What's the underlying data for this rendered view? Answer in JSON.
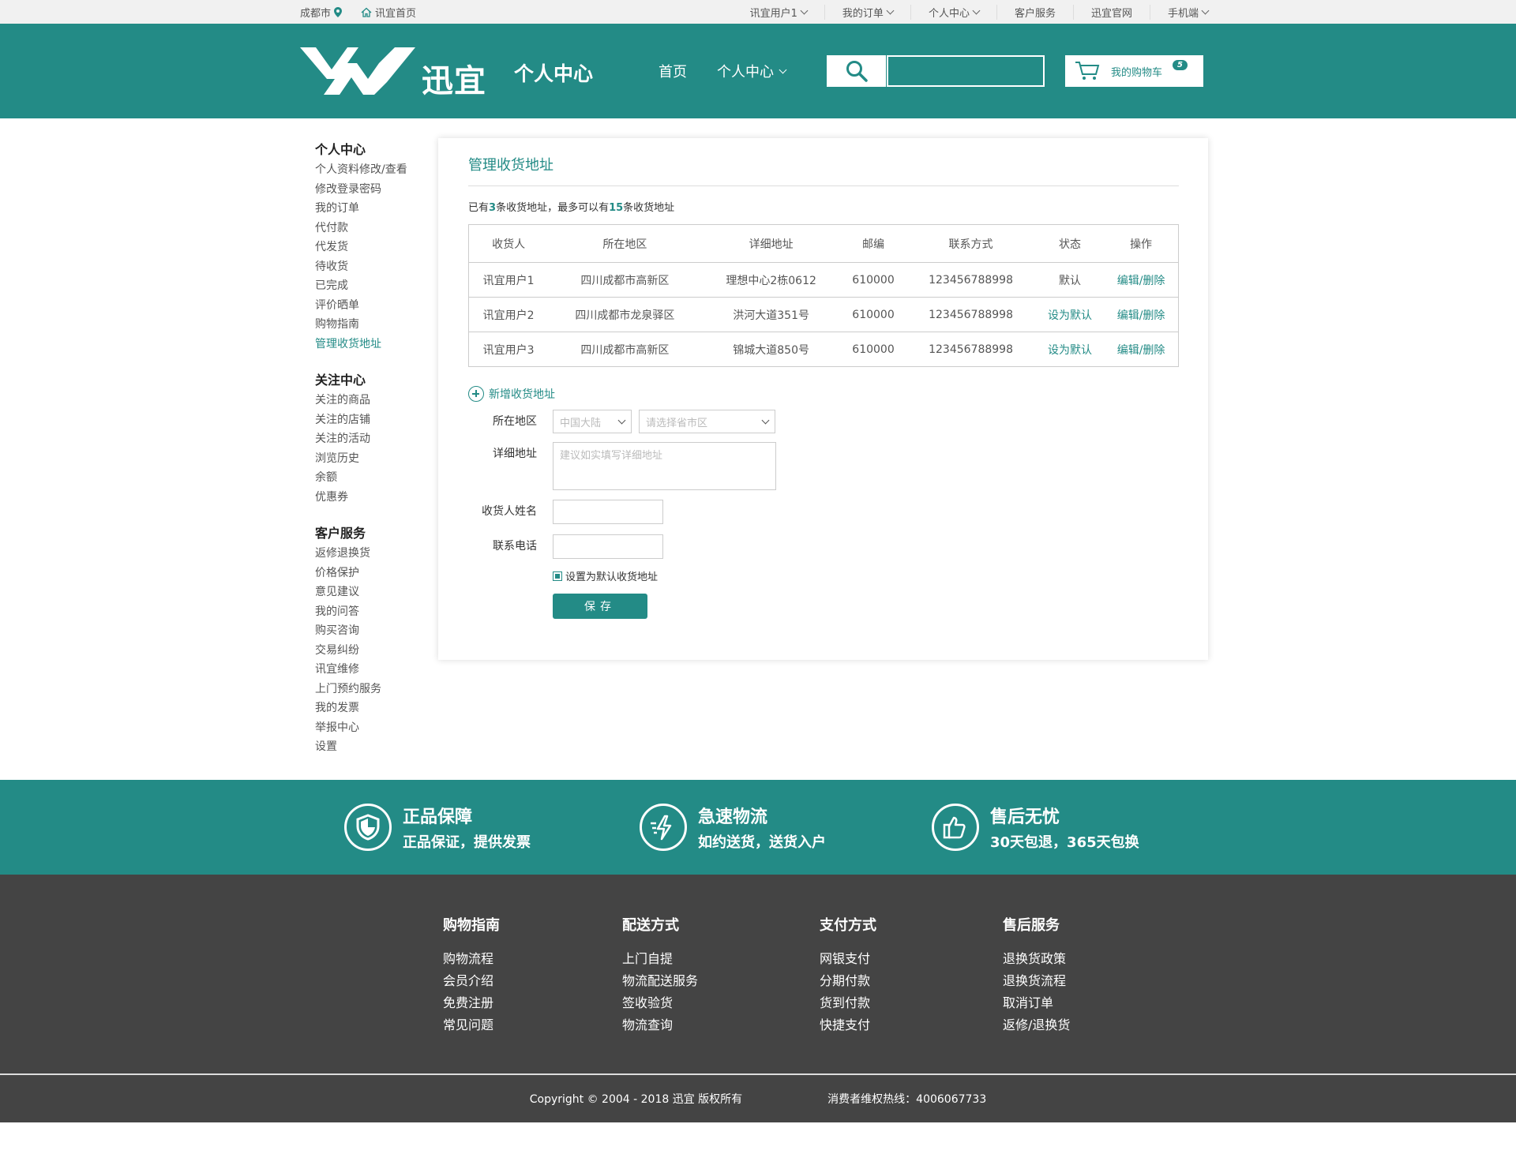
{
  "topbar": {
    "city": "成都市",
    "home": "讯宜首页",
    "links": [
      "讯宜用户1",
      "我的订单",
      "个人中心",
      "客户服务",
      "迅宜官网",
      "手机端"
    ]
  },
  "header": {
    "logo_text": "迅宜",
    "title": "个人中心",
    "nav": [
      "首页",
      "个人中心"
    ],
    "search_placeholder": "",
    "cart_label": "我的购物车",
    "cart_count": "5"
  },
  "sidebar": {
    "groups": [
      {
        "title": "个人中心",
        "items": [
          "个人资料修改/查看",
          "修改登录密码",
          "我的订单",
          "代付款",
          "代发货",
          "待收货",
          "已完成",
          "评价晒单",
          "购物指南",
          "管理收货地址"
        ]
      },
      {
        "title": "关注中心",
        "items": [
          "关注的商品",
          "关注的店铺",
          "关注的活动",
          "浏览历史",
          "余额",
          "优惠券"
        ]
      },
      {
        "title": "客户服务",
        "items": [
          "返修退换货",
          "价格保护",
          "意见建议",
          "我的问答",
          "购买咨询",
          "交易纠纷",
          "讯宜维修",
          "上门预约服务",
          "我的发票",
          "举报中心",
          "设置"
        ]
      }
    ],
    "active": "管理收货地址"
  },
  "main": {
    "title": "管理收货地址",
    "count_prefix": "已有",
    "count_have": "3",
    "count_mid": "条收货地址，最多可以有",
    "count_max": "15",
    "count_suffix": "条收货地址",
    "table": {
      "headers": [
        "收货人",
        "所在地区",
        "详细地址",
        "邮编",
        "联系方式",
        "状态",
        "操作"
      ],
      "rows": [
        [
          "讯宜用户1",
          "四川成都市高新区",
          "理想中心2栋0612",
          "610000",
          "123456788998",
          "默认",
          "编辑/删除"
        ],
        [
          "讯宜用户2",
          "四川成都市龙泉驿区",
          "洪河大道351号",
          "610000",
          "123456788998",
          "设为默认",
          "编辑/删除"
        ],
        [
          "讯宜用户3",
          "四川成都市高新区",
          "锦城大道850号",
          "610000",
          "123456788998",
          "设为默认",
          "编辑/删除"
        ]
      ]
    },
    "add_new": "新增收货地址",
    "form": {
      "region_label": "所在地区",
      "country_placeholder": "中国大陆",
      "province_placeholder": "请选择省市区",
      "address_label": "详细地址",
      "address_placeholder": "建议如实填写详细地址",
      "name_label": "收货人姓名",
      "phone_label": "联系电话",
      "default_checkbox": "设置为默认收货地址",
      "save": "保存"
    }
  },
  "services": [
    {
      "title": "正品保障",
      "sub": "正品保证，提供发票",
      "icon": "shield-icon"
    },
    {
      "title": "急速物流",
      "sub": "如约送货，送货入户",
      "icon": "lightning-icon"
    },
    {
      "title": "售后无忧",
      "sub": "30天包退，365天包换",
      "icon": "thumbs-up-icon"
    }
  ],
  "footer": {
    "columns": [
      {
        "title": "购物指南",
        "items": [
          "购物流程",
          "会员介绍",
          "免费注册",
          "常见问题"
        ]
      },
      {
        "title": "配送方式",
        "items": [
          "上门自提",
          "物流配送服务",
          "签收验货",
          "物流查询"
        ]
      },
      {
        "title": "支付方式",
        "items": [
          "网银支付",
          "分期付款",
          "货到付款",
          "快捷支付"
        ]
      },
      {
        "title": "售后服务",
        "items": [
          "退换货政策",
          "退换货流程",
          "取消订单",
          "返修/退换货"
        ]
      }
    ],
    "copyright": "Copyright © 2004 - 2018  迅宜 版权所有",
    "hotline": "消费者维权热线：4006067733"
  },
  "colors": {
    "accent": "#238b86",
    "footer_bg": "#444444"
  }
}
